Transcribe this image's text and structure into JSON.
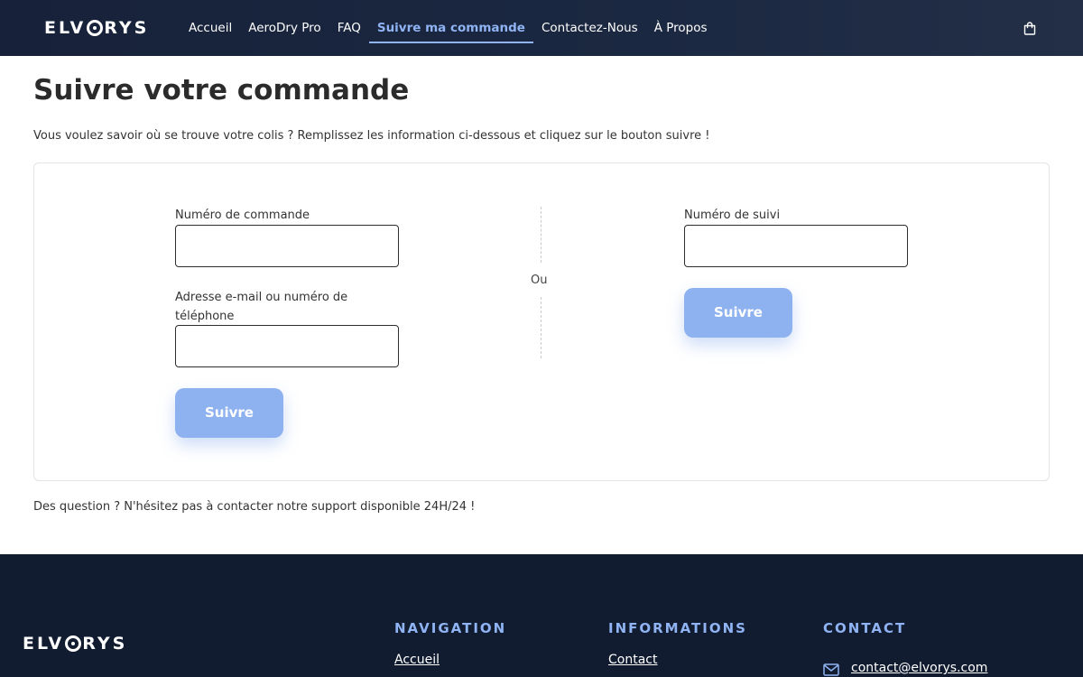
{
  "brand": {
    "name_prefix": "ELV",
    "name_suffix": "RYS"
  },
  "nav": {
    "items": [
      {
        "label": "Accueil"
      },
      {
        "label": "AeroDry Pro"
      },
      {
        "label": "FAQ"
      },
      {
        "label": "Suivre ma commande"
      },
      {
        "label": "Contactez-Nous"
      },
      {
        "label": "À Propos"
      }
    ],
    "active_index": 3
  },
  "page": {
    "title": "Suivre votre commande",
    "intro": "Vous voulez savoir où se trouve votre colis ? Remplissez les information ci-dessous et cliquez sur le bouton suivre !",
    "help": "Des question ? N'hésitez pas à contacter notre support disponible 24H/24 !"
  },
  "form": {
    "order_number_label": "Numéro de commande",
    "order_number_value": "",
    "contact_label": "Adresse e-mail ou numéro de téléphone",
    "contact_value": "",
    "submit_left": "Suivre",
    "or_label": "Ou",
    "tracking_label": "Numéro de suivi",
    "tracking_value": "",
    "submit_right": "Suivre"
  },
  "footer": {
    "navigation": {
      "title": "NAVIGATION",
      "items": [
        "Accueil"
      ]
    },
    "informations": {
      "title": "INFORMATIONS",
      "items": [
        "Contact"
      ]
    },
    "contact": {
      "title": "CONTACT",
      "email": "contact@elvorys.com"
    }
  },
  "colors": {
    "header_bg": "#17223a",
    "accent": "#8fb3f3",
    "button": "#8eb1ef",
    "footer_bg": "#121c30"
  },
  "icons": {
    "cart": "shopping-bag-icon",
    "mail": "envelope-icon",
    "logo_o": "swirl-o-icon"
  }
}
